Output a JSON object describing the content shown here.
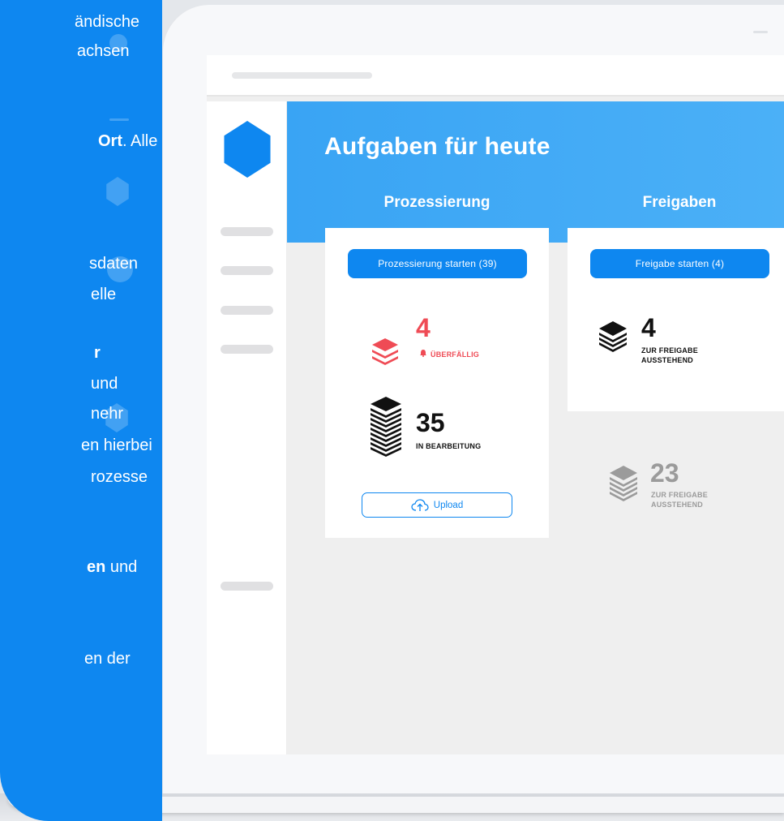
{
  "left_panel": {
    "lines": [
      {
        "pre": "ändische",
        "bold": "",
        "post": ""
      },
      {
        "pre": "achsen",
        "bold": "",
        "post": ""
      },
      {
        "pre": "",
        "bold": "Ort",
        "post": ". Alle"
      },
      {
        "pre": "sdaten",
        "bold": "",
        "post": ""
      },
      {
        "pre": "elle",
        "bold": "",
        "post": ""
      },
      {
        "pre": "",
        "bold": "r",
        "post": ""
      },
      {
        "pre": "und",
        "bold": "",
        "post": ""
      },
      {
        "pre": "nehr",
        "bold": "",
        "post": ""
      },
      {
        "pre": "en hierbei",
        "bold": "",
        "post": ""
      },
      {
        "pre": "rozesse",
        "bold": "",
        "post": ""
      },
      {
        "pre": "",
        "bold": "en",
        "post": " und"
      },
      {
        "pre": "en der",
        "bold": "",
        "post": ""
      }
    ]
  },
  "app": {
    "title": "Aufgaben für heute",
    "columns": [
      {
        "heading": "Prozessierung",
        "button": "Prozessierung starten (39)",
        "stats": [
          {
            "value": "4",
            "label": "ÜBERFÄLLIG",
            "color": "#ef4b55",
            "icon": "layers-icon"
          },
          {
            "value": "35",
            "label": "IN BEARBEITUNG",
            "color": "#111111",
            "icon": "stack-icon"
          }
        ],
        "upload_label": "Upload"
      },
      {
        "heading": "Freigaben",
        "button": "Freigabe starten (4)",
        "stats": [
          {
            "value": "4",
            "label_line1": "ZUR FREIGABE",
            "label_line2": "AUSSTEHEND",
            "color": "#111111",
            "icon": "layers-icon"
          }
        ],
        "faded_stat": {
          "value": "23",
          "label_line1": "ZUR FREIGABE",
          "label_line2": "AUSSTEHEND",
          "color": "#9b9b9b",
          "icon": "layers-icon"
        }
      }
    ]
  },
  "colors": {
    "brand_blue": "#0e87f0",
    "hero_blue": "#42aaf5",
    "alert_red": "#ef4b55",
    "muted_gray": "#9b9b9b"
  }
}
